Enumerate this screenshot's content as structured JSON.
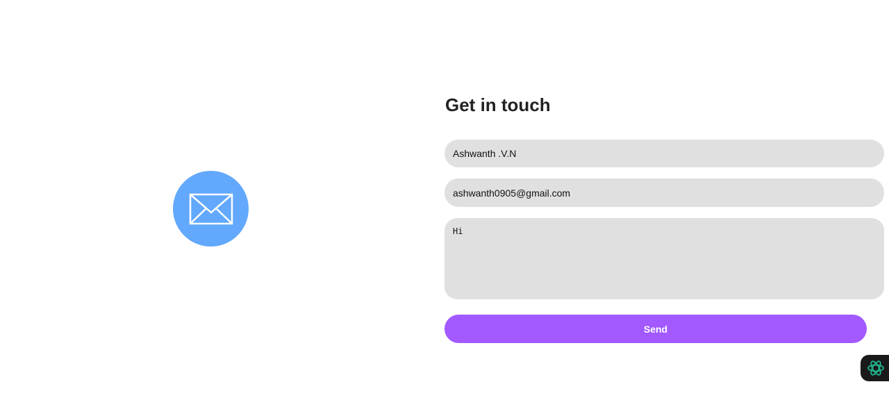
{
  "illustration": {
    "icon": "envelope-icon",
    "circle_color": "#62a8fd"
  },
  "form": {
    "title": "Get in touch",
    "name_value": "Ashwanth .V.N",
    "email_value": "ashwanth0905@gmail.com",
    "message_value": "Hi",
    "send_label": "Send",
    "field_background": "#e0e0e0",
    "button_color": "#a259ff"
  },
  "widget": {
    "icon": "ai-assistant-icon",
    "icon_color": "#1fb58f"
  }
}
